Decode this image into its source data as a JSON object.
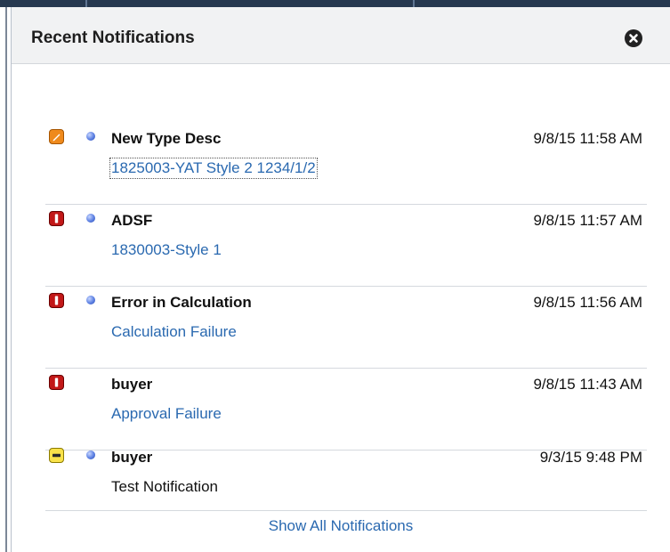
{
  "panel": {
    "title": "Recent Notifications",
    "close_icon": "close-circle-icon",
    "show_all_label": "Show All Notifications",
    "link_color": "#2a69b0"
  },
  "notifications": [
    {
      "type_icon": "edit-icon",
      "type_color": "#ef8a1c",
      "unread": true,
      "title": "New Type Desc",
      "time": "9/8/15 11:58 AM",
      "subtitle": "1825003-YAT Style 2 1234/1/2",
      "subtitle_is_link": true
    },
    {
      "type_icon": "error-icon",
      "type_color": "#c21818",
      "unread": true,
      "title": "ADSF",
      "time": "9/8/15 11:57 AM",
      "subtitle": "1830003-Style 1",
      "subtitle_is_link": true
    },
    {
      "type_icon": "error-icon",
      "type_color": "#c21818",
      "unread": true,
      "title": "Error in Calculation",
      "time": "9/8/15 11:56 AM",
      "subtitle": "Calculation Failure",
      "subtitle_is_link": true
    },
    {
      "type_icon": "error-icon",
      "type_color": "#c21818",
      "unread": false,
      "title": "buyer",
      "time": "9/8/15 11:43 AM",
      "subtitle": "Approval Failure",
      "subtitle_is_link": true
    },
    {
      "type_icon": "minus-icon",
      "type_color": "#f9e24a",
      "unread": true,
      "title": "buyer",
      "time": "9/3/15 9:48 PM",
      "subtitle": "Test Notification",
      "subtitle_is_link": false
    }
  ]
}
